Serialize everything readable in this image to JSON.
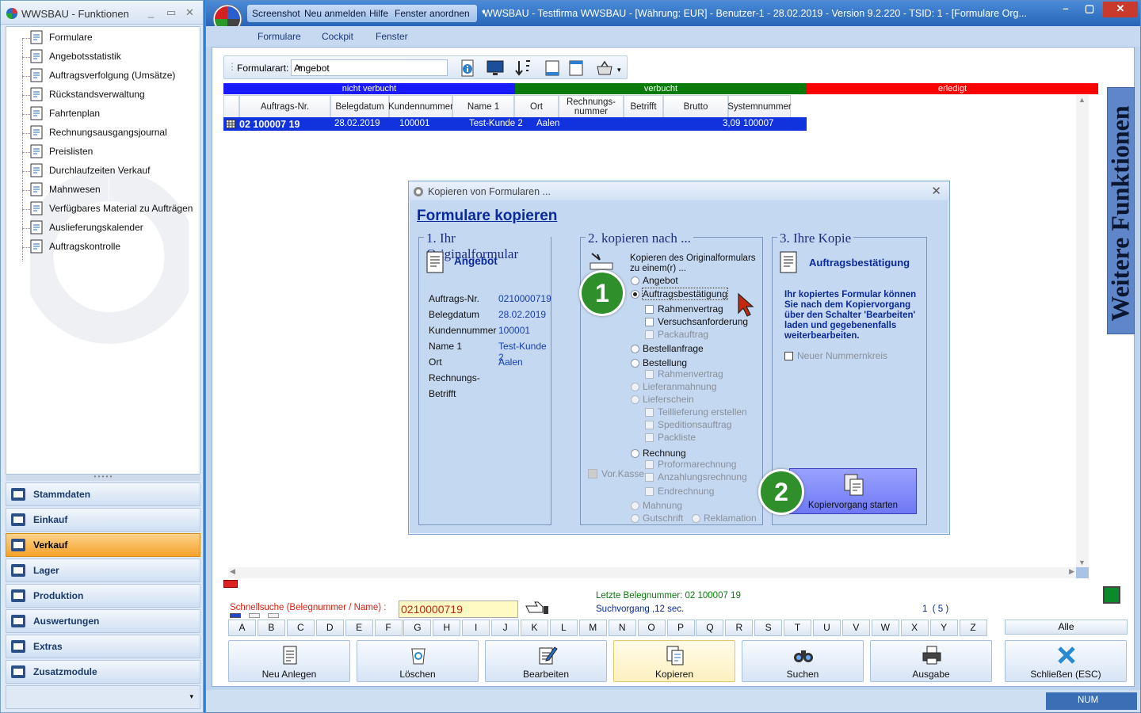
{
  "left_window": {
    "title": "WWSBAU - Funktionen",
    "tree": [
      {
        "label": "Formulare",
        "icon": "document-icon"
      },
      {
        "label": "Angebotsstatistik",
        "icon": "calendar-stats-icon"
      },
      {
        "label": "Auftragsverfolgung (Umsätze)",
        "icon": "tracking-icon"
      },
      {
        "label": "Rückstandsverwaltung",
        "icon": "clock-back-icon"
      },
      {
        "label": "Fahrtenplan",
        "icon": "truck-icon"
      },
      {
        "label": "Rechnungsausgangsjournal",
        "icon": "journal-icon"
      },
      {
        "label": "Preislisten",
        "icon": "price-tag-icon"
      },
      {
        "label": "Durchlaufzeiten Verkauf",
        "icon": "hourglass-icon"
      },
      {
        "label": "Mahnwesen",
        "icon": "paragraph-icon"
      },
      {
        "label": "Verfügbares Material zu Aufträgen",
        "icon": "material-icon"
      },
      {
        "label": "Auslieferungskalender",
        "icon": "calendar-icon"
      },
      {
        "label": "Auftragskontrolle",
        "icon": "checklist-icon"
      }
    ],
    "nav": [
      {
        "label": "Stammdaten",
        "icon": "master-data-icon",
        "selected": false
      },
      {
        "label": "Einkauf",
        "icon": "cart-icon",
        "selected": false
      },
      {
        "label": "Verkauf",
        "icon": "register-icon",
        "selected": true
      },
      {
        "label": "Lager",
        "icon": "warehouse-icon",
        "selected": false
      },
      {
        "label": "Produktion",
        "icon": "production-icon",
        "selected": false
      },
      {
        "label": "Auswertungen",
        "icon": "analytics-icon",
        "selected": false
      },
      {
        "label": "Extras",
        "icon": "extras-icon",
        "selected": false
      },
      {
        "label": "Zusatzmodule",
        "icon": "modules-icon",
        "selected": false
      }
    ]
  },
  "main_window": {
    "quick_access": [
      "Screenshot",
      "Neu anmelden",
      "Hilfe",
      "Fenster anordnen"
    ],
    "title": "WWSBAU - Testfirma WWSBAU - [Währung: EUR] - Benutzer-1 - 28.02.2019 - Version 9.2.220 - TSID: 1  - [Formulare Org...",
    "menu": [
      "Formulare",
      "Cockpit",
      "Fenster"
    ]
  },
  "toolbar": {
    "formularart_label": "Formularart:",
    "formularart_value": "Angebot"
  },
  "grid": {
    "bands": [
      {
        "label": "nicht verbucht",
        "color": "#1a1aff"
      },
      {
        "label": "verbucht",
        "color": "#0a7a0a"
      },
      {
        "label": "erledigt",
        "color": "#ff0000"
      }
    ],
    "columns": [
      "Auftrags-Nr.",
      "Belegdatum",
      "Kundennummer",
      "Name 1",
      "Ort",
      "Rechnungs-\nnummer",
      "Betrifft",
      "Brutto",
      "Systemnummer"
    ],
    "rows": [
      [
        "02 100007 19",
        "28.02.2019",
        "100001",
        "Test-Kunde 2",
        "Aalen",
        "",
        "",
        "3,09",
        "100007"
      ]
    ]
  },
  "dialog": {
    "title": "Kopieren von Formularen ...",
    "heading": "Formulare kopieren",
    "section1": {
      "title": "1. Ihr Originalformular",
      "form_name": "Angebot",
      "fields": [
        {
          "label": "Auftrags-Nr.",
          "value": "0210000719"
        },
        {
          "label": "Belegdatum",
          "value": "28.02.2019"
        },
        {
          "label": "Kundennummer",
          "value": "100001"
        },
        {
          "label": "Name 1",
          "value": "Test-Kunde 2"
        },
        {
          "label": "Ort",
          "value": "Aalen"
        },
        {
          "label": "Rechnungs-",
          "value": ""
        },
        {
          "label": "Betrifft",
          "value": ""
        }
      ]
    },
    "section2": {
      "title": "2. kopieren nach ...",
      "intro": "Kopieren des Originalformulars zu einem(r) ...",
      "options": {
        "angebot": "Angebot",
        "auftragsbestaetigung": "Auftragsbestätigung",
        "rahmenvertrag": "Rahmenvertrag",
        "versuchsanforderung": "Versuchsanforderung",
        "packauftrag": "Packauftrag",
        "bestellanfrage": "Bestellanfrage",
        "bestellung": "Bestellung",
        "rahmenvertrag2": "Rahmenvertrag",
        "lieferanmahnung": "Lieferanmahnung",
        "lieferschein": "Lieferschein",
        "teillieferung": "Teillieferung erstellen",
        "speditionsauftrag": "Speditionsauftrag",
        "packliste": "Packliste",
        "rechnung": "Rechnung",
        "proformarechnung": "Proformarechnung",
        "anzahlungsrechnung": "Anzahlungsrechnung",
        "endrechnung": "Endrechnung",
        "mahnung": "Mahnung",
        "gutschrift": "Gutschrift",
        "reklamation": "Reklamation",
        "vorkasse": "Vor.Kasse"
      },
      "selected": "Auftragsbestätigung"
    },
    "section3": {
      "title": "3. Ihre Kopie",
      "form_name": "Auftragsbestätigung",
      "info": "Ihr kopiertes Formular können Sie nach dem Kopiervorgang über den Schalter 'Bearbeiten' laden und gegebenenfalls weiterbearbeiten.",
      "checkbox": "Neuer Nummernkreis",
      "start_button": "Kopiervorgang starten"
    },
    "badges": [
      "1",
      "2"
    ]
  },
  "search": {
    "label": "Schnellsuche (Belegnummer / Name) :",
    "value": "0210000719",
    "last_number": "Letzte Belegnummer: 02 100007 19",
    "duration": "Suchvorgang ,12 sec.",
    "count": "1  ( 5 )"
  },
  "letters": [
    "A",
    "B",
    "C",
    "D",
    "E",
    "F",
    "G",
    "H",
    "I",
    "J",
    "K",
    "L",
    "M",
    "N",
    "O",
    "P",
    "Q",
    "R",
    "S",
    "T",
    "U",
    "V",
    "W",
    "X",
    "Y",
    "Z"
  ],
  "alle_label": "Alle",
  "buttons": [
    {
      "label": "Neu Anlegen",
      "icon": "new-document-icon"
    },
    {
      "label": "Löschen",
      "icon": "trash-icon"
    },
    {
      "label": "Bearbeiten",
      "icon": "edit-icon"
    },
    {
      "label": "Kopieren",
      "icon": "copy-icon"
    },
    {
      "label": "Suchen",
      "icon": "binoculars-icon"
    },
    {
      "label": "Ausgabe",
      "icon": "printer-icon"
    },
    {
      "label": "Schließen (ESC)",
      "icon": "close-icon"
    }
  ],
  "side_tab": "Weitere Funktionen",
  "statusbar": {
    "num": "NUM"
  }
}
